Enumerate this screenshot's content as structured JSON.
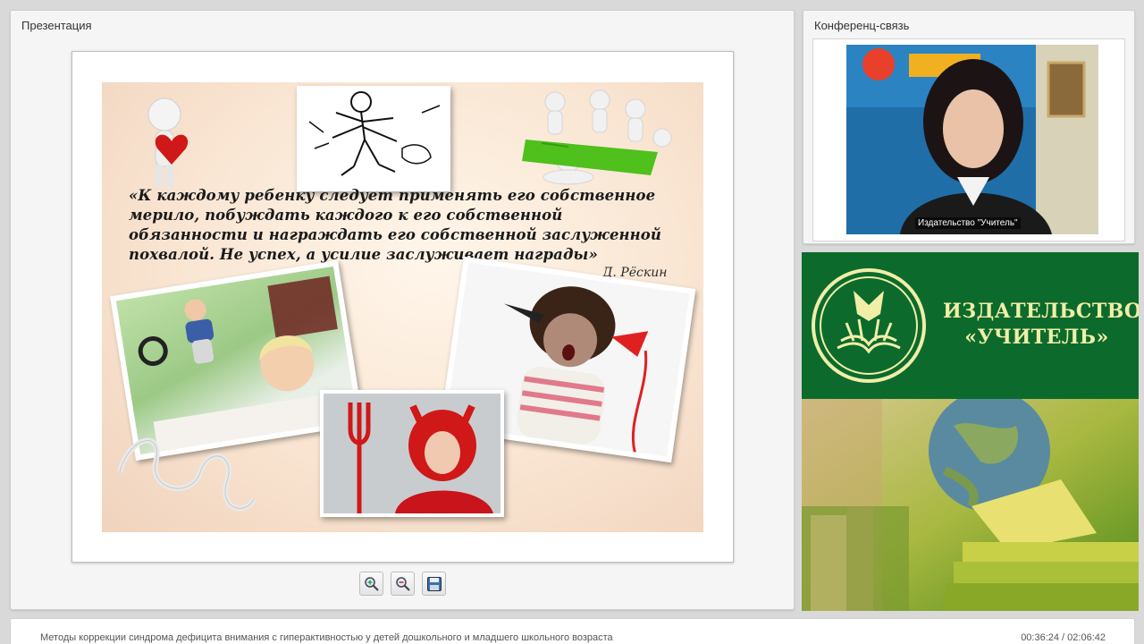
{
  "presentation": {
    "title": "Презентация",
    "slide": {
      "quote": "«К каждому ребенку следует применять его собственное мерило, побуждать каждого к его собственной обязанности и награждать его собственной заслуженной похвалой. Не успех, а усилие заслуживает награды»",
      "author": "Д. Рёскин"
    },
    "tools": {
      "zoom_in": "zoom-in-icon",
      "zoom_out": "zoom-out-icon",
      "save": "floppy-disk-icon"
    }
  },
  "conference": {
    "title": "Конференц-связь",
    "video_caption": "Издательство \"Учитель\""
  },
  "publisher": {
    "name_line1": "ИЗДАТЕЛЬСТВО",
    "name_line2": "«УЧИТЕЛЬ»",
    "colors": {
      "banner": "#0c6b2c",
      "text": "#f1eea8"
    }
  },
  "bottom": {
    "lecture_title": "Методы коррекции синдрома дефицита внимания с гиперактивностью у детей дошкольного и младшего школьного возраста",
    "time": "00:36:24 / 02:06:42"
  }
}
